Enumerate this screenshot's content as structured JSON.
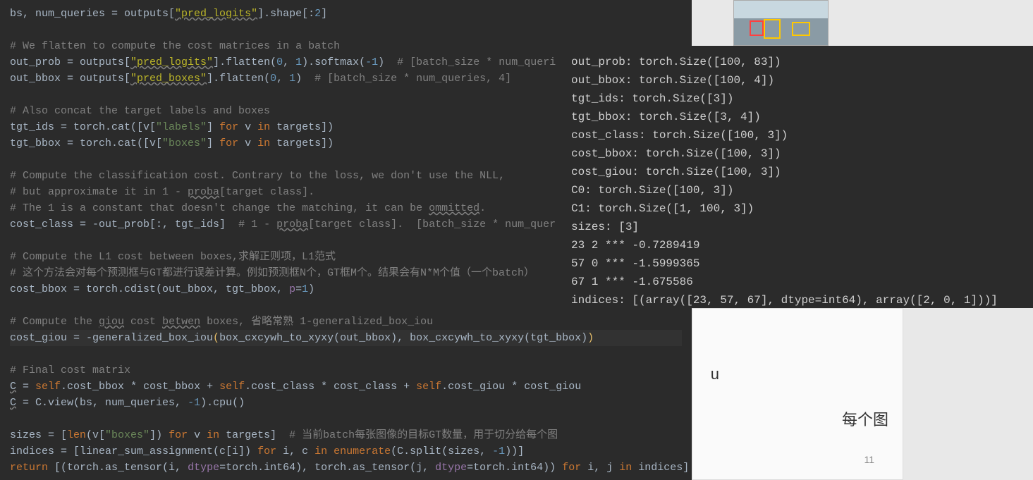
{
  "code": {
    "l1_a": "bs, num_queries = outputs[",
    "l1_s": "\"pred_logits\"",
    "l1_b": "].shape[:",
    "l1_n": "2",
    "l1_c": "]",
    "l3_c": "# We flatten to compute the cost matrices in a batch",
    "l4_a": "out_prob = outputs[",
    "l4_s": "\"pred_logits\"",
    "l4_b": "].flatten(",
    "l4_n1": "0",
    "l4_comma": ", ",
    "l4_n2": "1",
    "l4_c": ").softmax(",
    "l4_n3": "-1",
    "l4_d": ")  ",
    "l4_cm": "# [batch_size * num_queri",
    "l5_a": "out_bbox = outputs[",
    "l5_s": "\"pred_boxes\"",
    "l5_b": "].flatten(",
    "l5_n1": "0",
    "l5_comma": ", ",
    "l5_n2": "1",
    "l5_c": ")  ",
    "l5_cm": "# [batch_size * num_queries, 4]",
    "l7_c": "# Also concat the target labels and boxes",
    "l8_a": "tgt_ids = torch.cat([v[",
    "l8_s": "\"labels\"",
    "l8_b": "] ",
    "l8_k1": "for",
    "l8_c": " v ",
    "l8_k2": "in",
    "l8_d": " targets])",
    "l9_a": "tgt_bbox = torch.cat([v[",
    "l9_s": "\"boxes\"",
    "l9_b": "] ",
    "l9_k1": "for",
    "l9_c": " v ",
    "l9_k2": "in",
    "l9_d": " targets])",
    "l11_c": "# Compute the classification cost. Contrary to the loss, we don't use the NLL,",
    "l12_c1": "# but approximate it in 1 - ",
    "l12_u": "proba",
    "l12_c2": "[target class].",
    "l13_c1": "# The 1 is a constant that doesn't change the matching, it can be ",
    "l13_u": "ommitted",
    "l13_c2": ".",
    "l14_a": "cost_class = -out_prob[:, tgt_ids]  ",
    "l14_cm1": "# 1 - ",
    "l14_u": "proba",
    "l14_cm2": "[target class].  [batch_size * num_quer",
    "l16_c": "# Compute the L1 cost between boxes,求解正则项，L1范式",
    "l17_c": "# 这个方法会对每个预测框与GT都进行误差计算。例如预测框N个，GT框M个。结果会有N*M个值（一个batch）",
    "l18_a": "cost_bbox = torch.cdist(out_bbox, tgt_bbox, ",
    "l18_p": "p",
    "l18_eq": "=",
    "l18_n": "1",
    "l18_b": ")",
    "l20_c1": "# Compute the ",
    "l20_u1": "giou",
    "l20_c2": " cost ",
    "l20_u2": "betwen",
    "l20_c3": " boxes, 省略常熟 1-generalized_box_iou",
    "l21_a": "cost_giou = -generalized_box_iou",
    "l21_b": "(",
    "l21_c": "box_cxcywh_to_xyxy(out_bbox), box_cxcywh_to_xyxy(tgt_bbox)",
    "l21_d": ")",
    "l23_c": "# Final cost matrix",
    "l24_a": "C",
    "l24_b": " = ",
    "l24_k1": "self",
    "l24_c1": ".cost_bbox * cost_bbox + ",
    "l24_k2": "self",
    "l24_c2": ".cost_class * cost_class + ",
    "l24_k3": "self",
    "l24_c3": ".cost_giou * cost_giou",
    "l25_a": "C",
    "l25_b": " = C.view(bs, num_queries, ",
    "l25_n": "-1",
    "l25_c": ").cpu()",
    "l27_a": "sizes = [",
    "l27_fn": "len",
    "l27_b": "(v[",
    "l27_s": "\"boxes\"",
    "l27_c": "]) ",
    "l27_k1": "for",
    "l27_d": " v ",
    "l27_k2": "in",
    "l27_e": " targets]  ",
    "l27_cm": "# 当前batch每张图像的目标GT数量，用于切分给每个图",
    "l28_a": "indices = [linear_sum_assignment(c[i]) ",
    "l28_k1": "for",
    "l28_b": " i, c ",
    "l28_k2": "in",
    "l28_c": " ",
    "l28_fn": "enumerate",
    "l28_d": "(C.split(sizes, ",
    "l28_n": "-1",
    "l28_e": "))]",
    "l29_k1": "return",
    "l29_a": " [(torch.as_tensor(i, ",
    "l29_p1": "dtype",
    "l29_b": "=torch.int64), torch.as_tensor(j, ",
    "l29_p2": "dtype",
    "l29_c": "=torch.int64)) ",
    "l29_k2": "for",
    "l29_d": " i, j ",
    "l29_k3": "in",
    "l29_e": " indices]"
  },
  "output": {
    "l1": "out_prob: torch.Size([100, 83])",
    "l2": "out_bbox: torch.Size([100, 4])",
    "l3": "tgt_ids: torch.Size([3])",
    "l4": "tgt_bbox: torch.Size([3, 4])",
    "l5": "cost_class: torch.Size([100, 3])",
    "l6": "cost_bbox: torch.Size([100, 3])",
    "l7": "cost_giou: torch.Size([100, 3])",
    "l8": "C0: torch.Size([100, 3])",
    "l9": "C1: torch.Size([1, 100, 3])",
    "l10": "sizes: [3]",
    "l11": "23 2 *** -0.7289419",
    "l12": "57 0 *** -1.5999365",
    "l13": "67 1 *** -1.675586",
    "l14": "indices: [(array([23, 57, 67], dtype=int64), array([2, 0, 1]))]"
  },
  "slide": {
    "page": "11",
    "text1": "每个图",
    "text2": "u"
  }
}
